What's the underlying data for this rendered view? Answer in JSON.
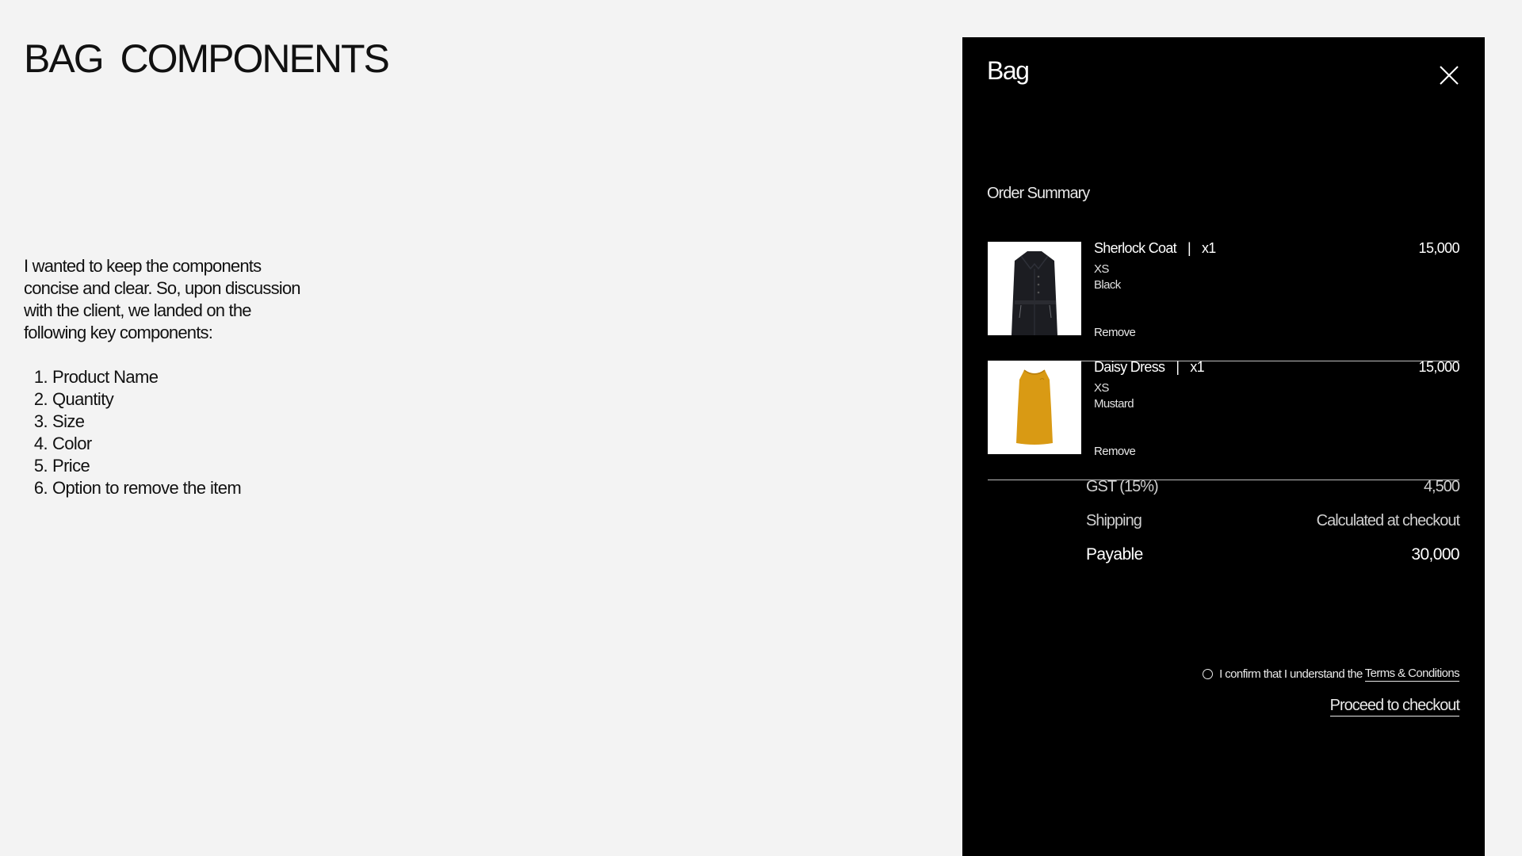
{
  "page": {
    "title": "BAG  COMPONENTS",
    "intro": "I wanted to keep the components concise and clear. So, upon discussion with the client, we landed on the  following key components:",
    "components": [
      {
        "num": "1.",
        "label": "Product Name"
      },
      {
        "num": "2.",
        "label": "Quantity"
      },
      {
        "num": "3.",
        "label": "Size"
      },
      {
        "num": "4.",
        "label": "Color"
      },
      {
        "num": "5.",
        "label": "Price"
      },
      {
        "num": "6.",
        "label": "Option to remove the item"
      }
    ]
  },
  "bag": {
    "title": "Bag",
    "close_icon": "close-icon",
    "order_summary": "Order Summary",
    "items": [
      {
        "name": "Sherlock Coat",
        "separator": "|",
        "quantity": "x1",
        "size": "XS",
        "color": "Black",
        "price": "15,000",
        "remove": "Remove",
        "image_icon": "coat-image",
        "swatch": "#1c1d22"
      },
      {
        "name": "Daisy Dress",
        "separator": "|",
        "quantity": "x1",
        "size": "XS",
        "color": "Mustard",
        "price": "15,000",
        "remove": "Remove",
        "image_icon": "dress-image",
        "swatch": "#d99a14"
      }
    ],
    "totals": {
      "gst_label": "GST (15%)",
      "gst_value": "4,500",
      "shipping_label": "Shipping",
      "shipping_value": "Calculated at checkout",
      "payable_label": "Payable",
      "payable_value": "30,000"
    },
    "confirm_text": "I confirm that I understand the",
    "terms_link": "Terms & Conditions",
    "checkout_button": "Proceed to checkout"
  },
  "colors": {
    "page_background": "#f3f3f3",
    "panel_background": "#000000",
    "panel_text": "#ffffff"
  }
}
